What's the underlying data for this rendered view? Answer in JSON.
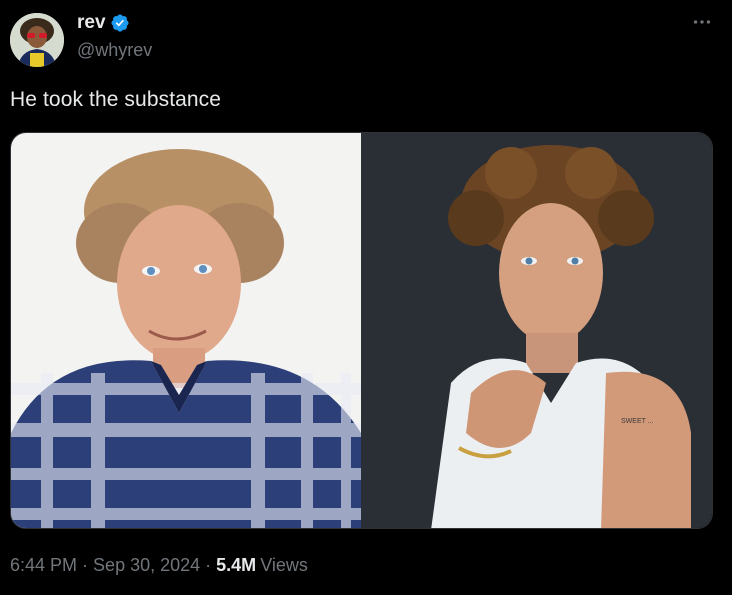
{
  "tweet": {
    "author": {
      "display_name": "rev",
      "handle": "@whyrev",
      "verified": true,
      "verified_color": "#1d9bf0"
    },
    "text": "He took the substance",
    "more_icon": "more-horizontal-icon",
    "media": [
      {
        "name": "left-photo"
      },
      {
        "name": "right-photo"
      }
    ],
    "meta": {
      "time": "6:44 PM",
      "separator": "·",
      "date": "Sep 30, 2024",
      "views_count": "5.4M",
      "views_label": "Views"
    }
  },
  "colors": {
    "background": "#000000",
    "text_primary": "#e7e9ea",
    "text_secondary": "#71767b",
    "border": "#2f3336"
  }
}
